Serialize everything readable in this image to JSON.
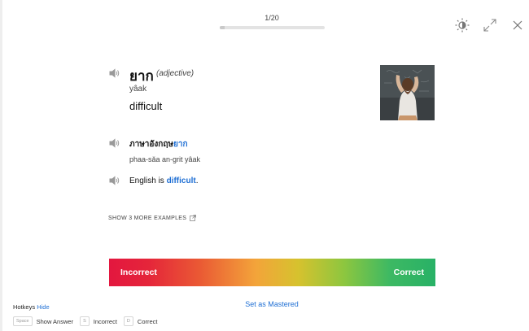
{
  "header": {
    "progress_text": "1/20",
    "progress_fraction": 0.05
  },
  "toolbar": {
    "theme_icon": "brightness-icon",
    "expand_icon": "expand-icon",
    "close_icon": "close-icon"
  },
  "card": {
    "word": "ยาก",
    "part_of_speech": "(adjective)",
    "transliteration": "yâak",
    "meaning": "difficult",
    "example": {
      "thai_prefix": "ภาษาอังกฤษ",
      "thai_highlight": "ยาก",
      "transliteration": "phaa-sǎa an-grit yâak",
      "english_prefix": "English is ",
      "english_highlight": "difficult",
      "english_suffix": "."
    },
    "more_examples_label": "SHOW 3 MORE EXAMPLES"
  },
  "grading": {
    "incorrect_label": "Incorrect",
    "correct_label": "Correct",
    "colors": [
      "#e3173f",
      "#f3a43a",
      "#8dc63f",
      "#28b166"
    ]
  },
  "mastered_label": "Set as Mastered",
  "hotkeys": {
    "title": "Hotkeys",
    "toggle_label": "Hide",
    "items": [
      {
        "key": "Space",
        "label": "Show Answer"
      },
      {
        "key": "S",
        "label": "Incorrect"
      },
      {
        "key": "D",
        "label": "Correct"
      }
    ]
  },
  "accent_color": "#1f6fd4"
}
